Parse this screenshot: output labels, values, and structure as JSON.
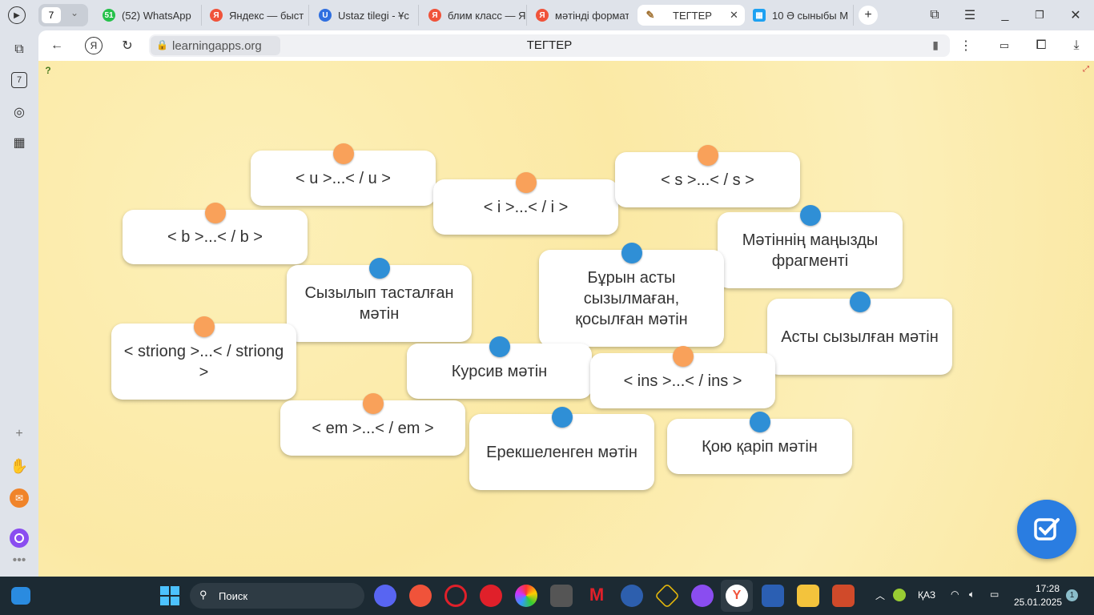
{
  "browser": {
    "tab_count": "7",
    "tabs": [
      {
        "label": "(52) WhatsApp",
        "badge": "51",
        "color": "#25c14a"
      },
      {
        "label": "Яндекс — быст",
        "badge": "Я",
        "color": "#f0533a"
      },
      {
        "label": "Ustaz tilegi - Ұс",
        "badge": "U",
        "color": "#2f6fe0"
      },
      {
        "label": "блим класс — Я",
        "badge": "Я",
        "color": "#f0533a"
      },
      {
        "label": "мәтінді формат",
        "badge": "Я",
        "color": "#f0533a"
      },
      {
        "label": "ТЕГТЕР",
        "badge": "✎",
        "color": "#c9a060"
      },
      {
        "label": "10 Ә сыныбы М",
        "badge": "▦",
        "color": "#1da1f2"
      }
    ],
    "url": "learningapps.org",
    "page_title": "ТЕГТЕР",
    "sidebar_badge": "7"
  },
  "cards": [
    {
      "text": "< u >...< / u >",
      "dot": "orange"
    },
    {
      "text": "< i >...< / i >",
      "dot": "orange"
    },
    {
      "text": "< s >...< / s >",
      "dot": "orange"
    },
    {
      "text": "< b >...< / b >",
      "dot": "orange"
    },
    {
      "text": "Мәтіннің маңызды фрагменті",
      "dot": "blue"
    },
    {
      "text": "Сызылып тасталған мәтін",
      "dot": "blue"
    },
    {
      "text": "Бұрын асты сызылмаған, қосылған мәтін",
      "dot": "blue"
    },
    {
      "text": "Асты сызылған мәтін",
      "dot": "blue"
    },
    {
      "text": "< striong >...< / striong >",
      "dot": "orange"
    },
    {
      "text": "Курсив мәтін",
      "dot": "blue"
    },
    {
      "text": "< ins >...< / ins >",
      "dot": "orange"
    },
    {
      "text": "< em >...< / em >",
      "dot": "orange"
    },
    {
      "text": "Ерекшеленген мәтін",
      "dot": "blue"
    },
    {
      "text": "Қою қаріп мәтін",
      "dot": "blue"
    }
  ],
  "colors": {
    "orange": "#f9a15a",
    "blue": "#2f8fd6",
    "check": "#2a7de1"
  },
  "taskbar": {
    "search": "Поиск",
    "lang": "ҚАЗ",
    "time": "17:28",
    "date": "25.01.2025",
    "notif": "1"
  }
}
